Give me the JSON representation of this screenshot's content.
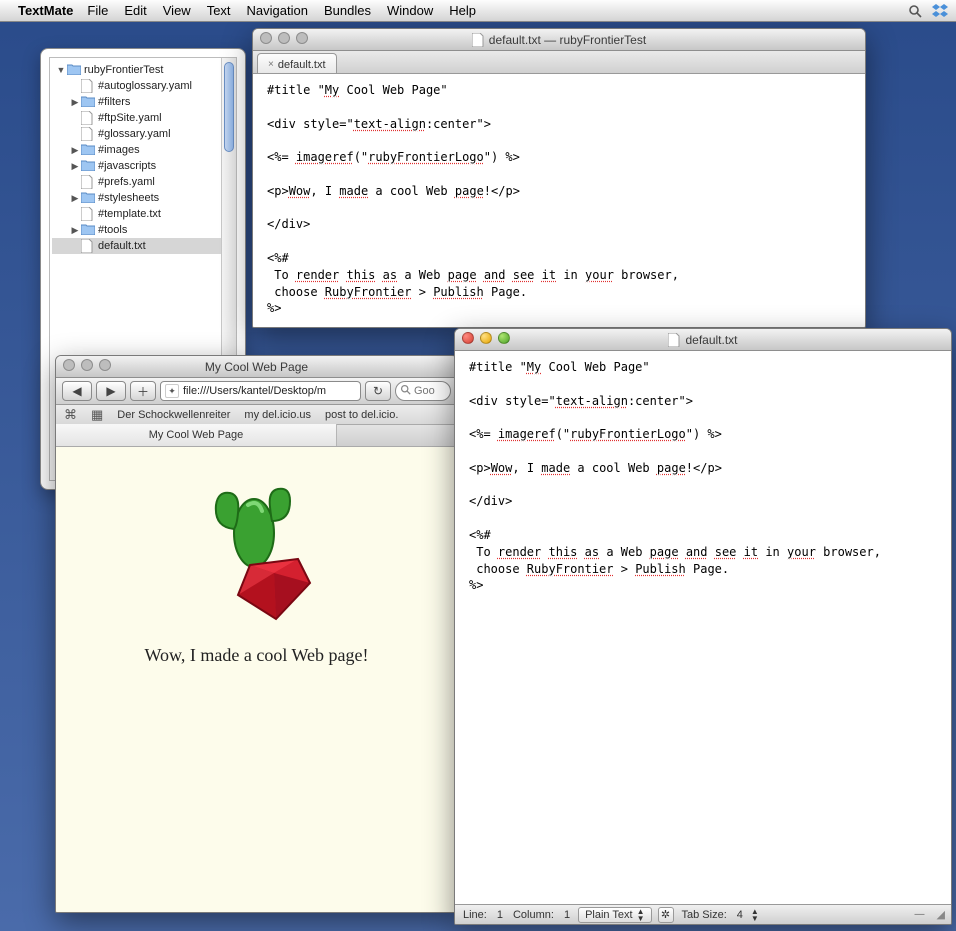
{
  "menubar": {
    "app": "TextMate",
    "items": [
      "File",
      "Edit",
      "View",
      "Text",
      "Navigation",
      "Bundles",
      "Window",
      "Help"
    ]
  },
  "drawer": {
    "root": "rubyFrontierTest",
    "items": [
      {
        "name": "#autoglossary.yaml",
        "type": "file",
        "depth": 1
      },
      {
        "name": "#filters",
        "type": "folder",
        "depth": 1
      },
      {
        "name": "#ftpSite.yaml",
        "type": "file",
        "depth": 1
      },
      {
        "name": "#glossary.yaml",
        "type": "file",
        "depth": 1
      },
      {
        "name": "#images",
        "type": "folder",
        "depth": 1
      },
      {
        "name": "#javascripts",
        "type": "folder",
        "depth": 1
      },
      {
        "name": "#prefs.yaml",
        "type": "file",
        "depth": 1
      },
      {
        "name": "#stylesheets",
        "type": "folder",
        "depth": 1
      },
      {
        "name": "#template.txt",
        "type": "file",
        "depth": 1
      },
      {
        "name": "#tools",
        "type": "folder",
        "depth": 1
      },
      {
        "name": "default.txt",
        "type": "file",
        "depth": 1,
        "selected": true
      }
    ]
  },
  "win_main": {
    "title": "default.txt — rubyFrontierTest",
    "tab": "default.txt"
  },
  "editor_code": {
    "l1a": "#title \"",
    "l1b": "My",
    "l1c": " Cool Web Page\"",
    "l2a": "<div style=\"",
    "l2b": "text-align",
    "l2c": ":center\">",
    "l3a": "<%= ",
    "l3b": "imageref",
    "l3c": "(\"",
    "l3d": "rubyFrontierLogo",
    "l3e": "\") %>",
    "l4a": "<p>",
    "l4b": "Wow",
    "l4c": ", I ",
    "l4d": "made",
    "l4e": " a cool Web ",
    "l4f": "page",
    "l4g": "!</p>",
    "l5": "</div>",
    "l6": "<%#",
    "l7a": " To ",
    "l7b": "render",
    "l7c": " ",
    "l7d": "this",
    "l7e": " ",
    "l7f": "as",
    "l7g": " a Web ",
    "l7h": "page",
    "l7i": " ",
    "l7j": "and",
    "l7k": " ",
    "l7l": "see",
    "l7m": " ",
    "l7n": "it",
    "l7o": " in ",
    "l7p": "your",
    "l7q": " browser,",
    "l8a": " choose ",
    "l8b": "RubyFrontier",
    "l8c": " > ",
    "l8d": "Publish",
    "l8e": " Page.",
    "l9": "%>"
  },
  "win_second": {
    "title": "default.txt",
    "status": {
      "line_label": "Line:",
      "line": "1",
      "col_label": "Column:",
      "col": "1",
      "lang": "Plain Text",
      "tab_label": "Tab Size:",
      "tab": "4"
    }
  },
  "safari": {
    "title": "My Cool Web Page",
    "url": "file:///Users/kantel/Desktop/m",
    "search_placeholder": "Goo",
    "bookmarks": [
      "Der Schockwellenreiter",
      "my del.icio.us",
      "post to del.icio."
    ],
    "tab": "My Cool Web Page",
    "headline": "Wow, I made a cool Web page!"
  }
}
